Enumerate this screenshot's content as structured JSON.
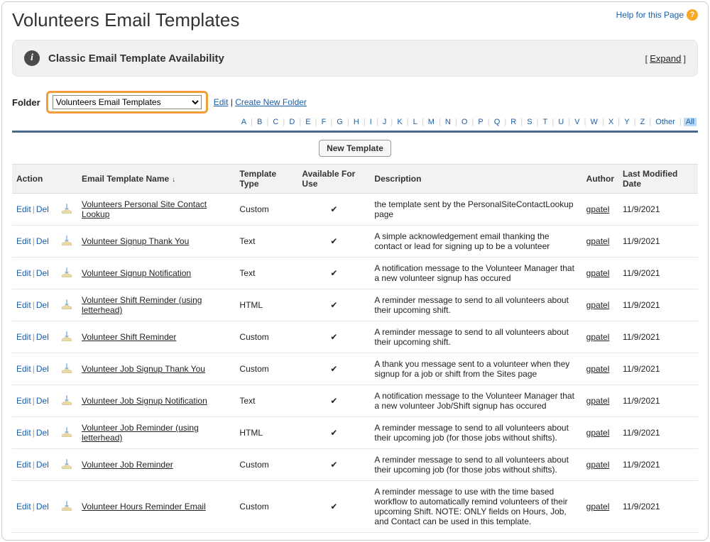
{
  "help_link": "Help for this Page",
  "page_title": "Volunteers Email Templates",
  "banner": {
    "title": "Classic Email Template Availability",
    "expand": "Expand"
  },
  "folder": {
    "label": "Folder",
    "selected": "Volunteers Email Templates",
    "edit": "Edit",
    "create": "Create New Folder"
  },
  "alpha": [
    "A",
    "B",
    "C",
    "D",
    "E",
    "F",
    "G",
    "H",
    "I",
    "J",
    "K",
    "L",
    "M",
    "N",
    "O",
    "P",
    "Q",
    "R",
    "S",
    "T",
    "U",
    "V",
    "W",
    "X",
    "Y",
    "Z"
  ],
  "alpha_other": "Other",
  "alpha_all": "All",
  "new_template_btn": "New Template",
  "columns": {
    "action": "Action",
    "name": "Email Template Name",
    "type": "Template Type",
    "available": "Available For Use",
    "description": "Description",
    "author": "Author",
    "modified": "Last Modified Date"
  },
  "action_labels": {
    "edit": "Edit",
    "del": "Del"
  },
  "rows": [
    {
      "name": "Volunteers Personal Site Contact Lookup",
      "type": "Custom",
      "available": true,
      "description": "the template sent by the PersonalSiteContactLookup page",
      "author": "gpatel",
      "modified": "11/9/2021"
    },
    {
      "name": "Volunteer Signup Thank You",
      "type": "Text",
      "available": true,
      "description": "A simple acknowledgement email thanking the contact or lead for signing up to be a volunteer",
      "author": "gpatel",
      "modified": "11/9/2021"
    },
    {
      "name": "Volunteer Signup Notification",
      "type": "Text",
      "available": true,
      "description": "A notification message to the Volunteer Manager that a new volunteer signup has occured",
      "author": "gpatel",
      "modified": "11/9/2021"
    },
    {
      "name": "Volunteer Shift Reminder (using letterhead)",
      "type": "HTML",
      "available": true,
      "description": "A reminder message to send to all volunteers about their upcoming shift.",
      "author": "gpatel",
      "modified": "11/9/2021"
    },
    {
      "name": "Volunteer Shift Reminder",
      "type": "Custom",
      "available": true,
      "description": "A reminder message to send to all volunteers about their upcoming shift.",
      "author": "gpatel",
      "modified": "11/9/2021"
    },
    {
      "name": "Volunteer Job Signup Thank You",
      "type": "Custom",
      "available": true,
      "description": "A thank you message sent to a volunteer when they signup for a job or shift from the Sites page",
      "author": "gpatel",
      "modified": "11/9/2021"
    },
    {
      "name": "Volunteer Job Signup Notification",
      "type": "Text",
      "available": true,
      "description": "A notification message to the Volunteer Manager that a new volunteer Job/Shift signup has occured",
      "author": "gpatel",
      "modified": "11/9/2021"
    },
    {
      "name": "Volunteer Job Reminder (using letterhead)",
      "type": "HTML",
      "available": true,
      "description": "A reminder message to send to all volunteers about their upcoming job (for those jobs without shifts).",
      "author": "gpatel",
      "modified": "11/9/2021"
    },
    {
      "name": "Volunteer Job Reminder",
      "type": "Custom",
      "available": true,
      "description": "A reminder message to send to all volunteers about their upcoming job (for those jobs without shifts).",
      "author": "gpatel",
      "modified": "11/9/2021"
    },
    {
      "name": "Volunteer Hours Reminder Email",
      "type": "Custom",
      "available": true,
      "description": "A reminder message to use with the time based workflow to automatically remind volunteers of their upcoming Shift. NOTE: ONLY fields on Hours, Job, and Contact can be used in this template.",
      "author": "gpatel",
      "modified": "11/9/2021"
    }
  ]
}
